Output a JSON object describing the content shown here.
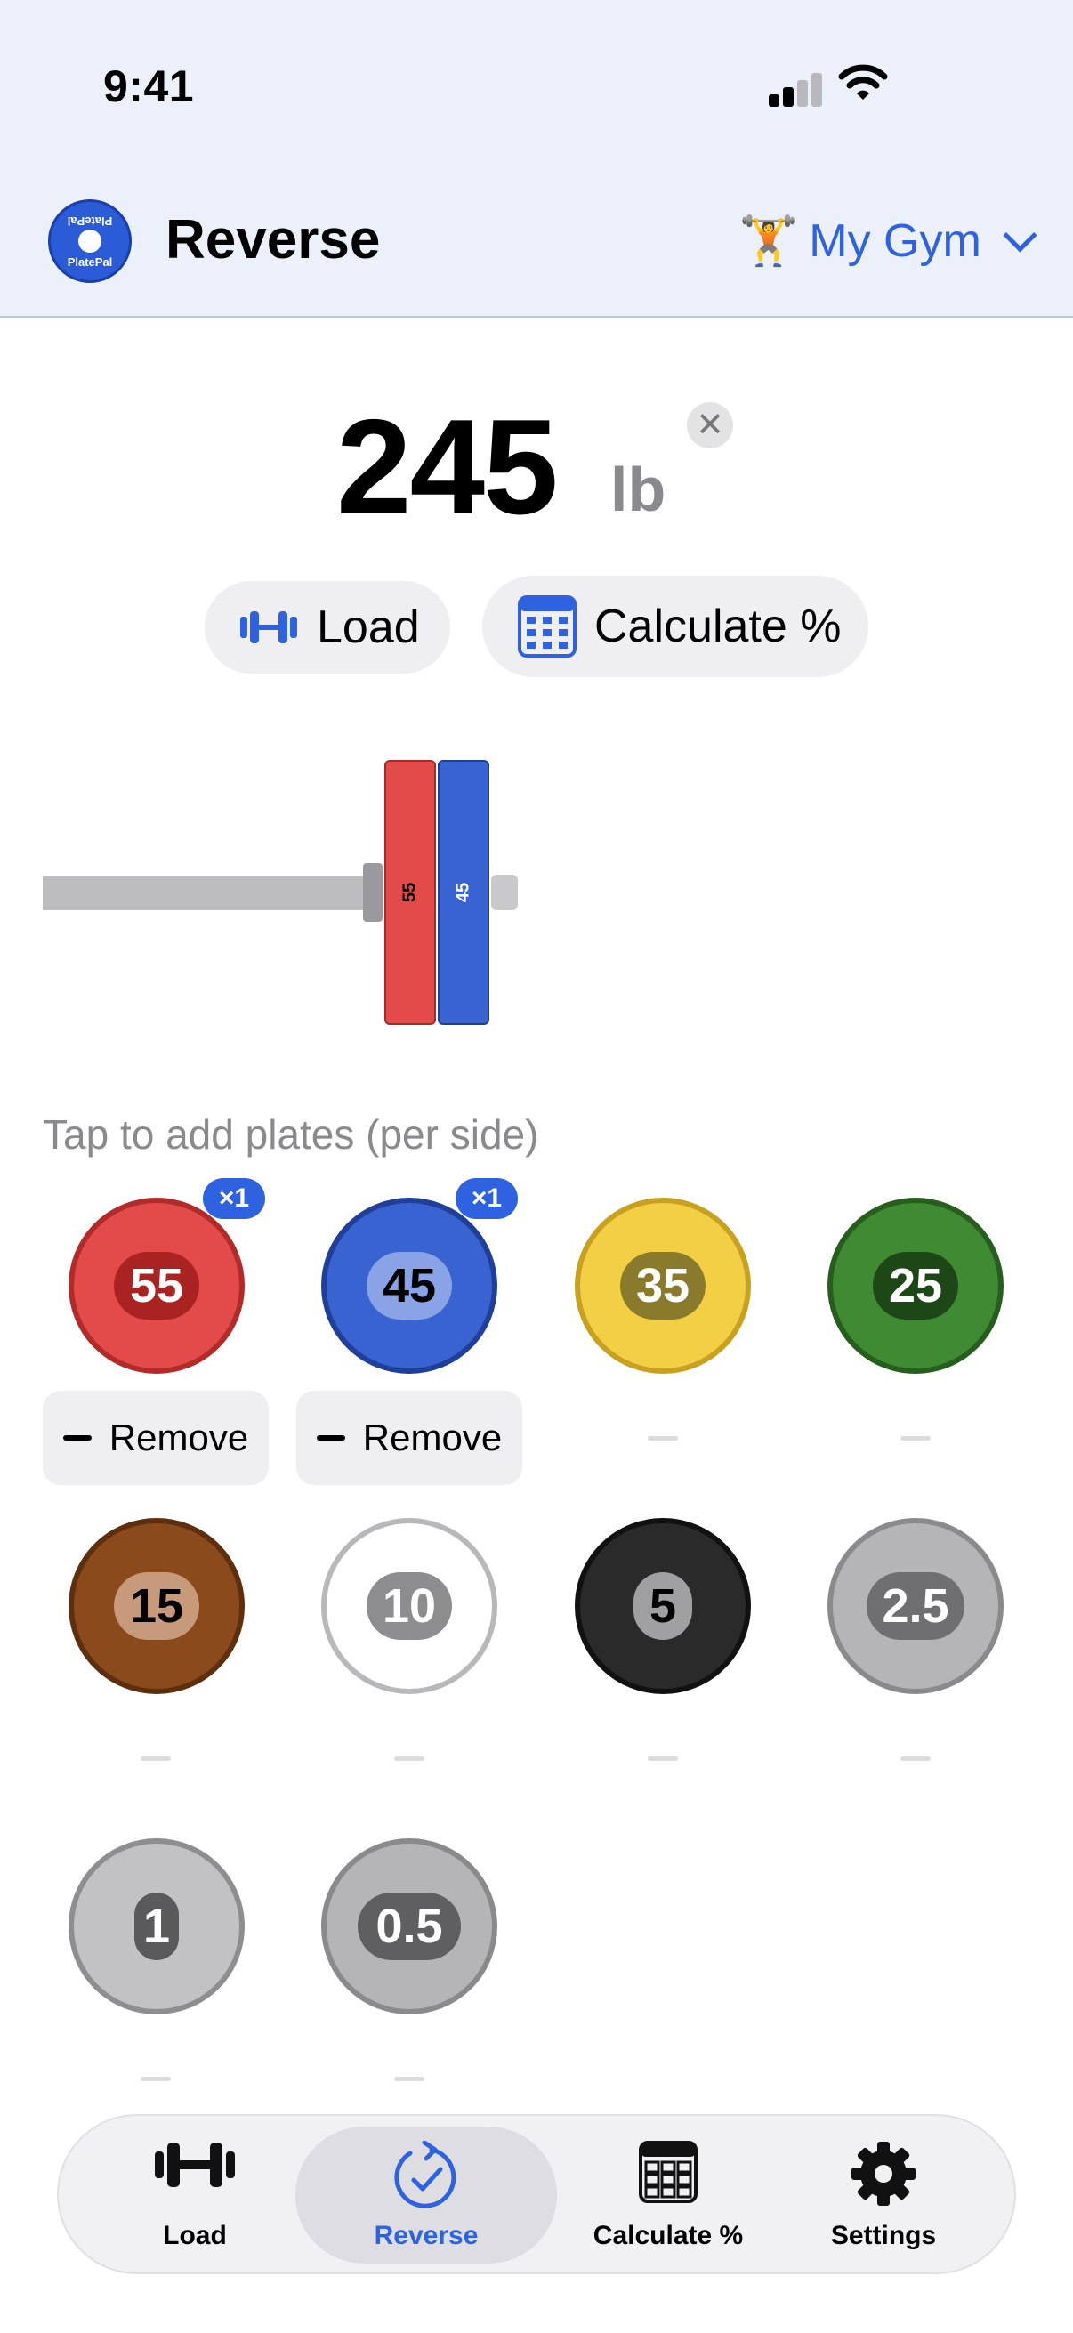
{
  "status_bar": {
    "time": "9:41"
  },
  "header": {
    "logo_text": "PlatePal",
    "title": "Reverse",
    "gym_emoji": "🏋️",
    "gym_label": "My Gym"
  },
  "total": {
    "value": "245",
    "unit": "lb",
    "clear_symbol": "✕"
  },
  "actions": {
    "load_label": "Load",
    "calculate_label": "Calculate %"
  },
  "bar_diagram": {
    "loaded_plates": [
      {
        "label": "55",
        "color": "#e34a4a"
      },
      {
        "label": "45",
        "color": "#3a63d2"
      }
    ]
  },
  "hint": "Tap to add plates (per side)",
  "plates": [
    {
      "label": "55",
      "count_badge": "×1",
      "remove_label": "Remove",
      "color": "#e34a4a"
    },
    {
      "label": "45",
      "count_badge": "×1",
      "remove_label": "Remove",
      "color": "#3a63d2"
    },
    {
      "label": "35",
      "color": "#f3cf45"
    },
    {
      "label": "25",
      "color": "#3f8a32"
    },
    {
      "label": "15",
      "color": "#8a4a1c"
    },
    {
      "label": "10",
      "color": "#ffffff"
    },
    {
      "label": "5",
      "color": "#2a2a2a"
    },
    {
      "label": "2.5",
      "color": "#b5b5b8"
    },
    {
      "label": "1",
      "color": "#c2c2c5"
    },
    {
      "label": "0.5",
      "color": "#b5b5b8"
    }
  ],
  "tabbar": {
    "tabs": [
      {
        "label": "Load",
        "icon": "barbell-icon"
      },
      {
        "label": "Reverse",
        "icon": "reverse-check-icon",
        "active": true
      },
      {
        "label": "Calculate %",
        "icon": "calculator-icon"
      },
      {
        "label": "Settings",
        "icon": "gear-icon"
      }
    ]
  },
  "colors": {
    "accent": "#2f62e0",
    "header_bg": "#ebf0fa"
  }
}
